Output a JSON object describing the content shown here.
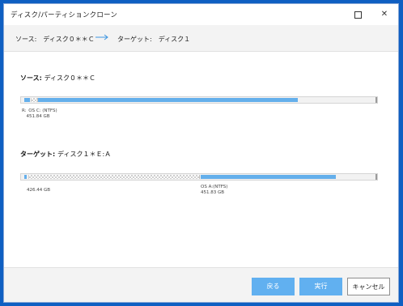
{
  "window": {
    "title": "ディスク/パーティションクローン",
    "maximize_label": "□",
    "close_label": "✕"
  },
  "route": {
    "source_text": "ソース:　ディスク０＊＊Ｃ",
    "arrow_icon": "right-arrow-icon",
    "target_text": "ターゲット:　ディスク１"
  },
  "source_disk": {
    "label": "ソース:",
    "disk_name": "ディスク０＊＊Ｃ",
    "partitions": [
      {
        "letter": "R:",
        "text": "",
        "used_fraction": 1.0
      },
      {
        "letter": "",
        "text": "",
        "used_fraction": 0.0
      },
      {
        "letter": "C:",
        "name": "OS (NTFS)",
        "size": "451.84 GB",
        "used_fraction": 1.0
      }
    ],
    "partition_name_line": "R: OS C: (NTFS)",
    "partition_size_line": "  451.84 GB"
  },
  "target_disk": {
    "label": "ターゲット:",
    "disk_name": "ディスク１＊Ｅ:Ａ",
    "unallocated": {
      "size": "426.44 GB"
    },
    "partition": {
      "name": "OS A:(NTFS)",
      "size": "451.83 GB"
    }
  },
  "footer": {
    "back_label": "戻る",
    "execute_label": "実行",
    "cancel_label": "キャンセル"
  },
  "colors": {
    "accent": "#61b0f0",
    "partition_blue": "#64afeb",
    "background": "#0f5fc2"
  }
}
